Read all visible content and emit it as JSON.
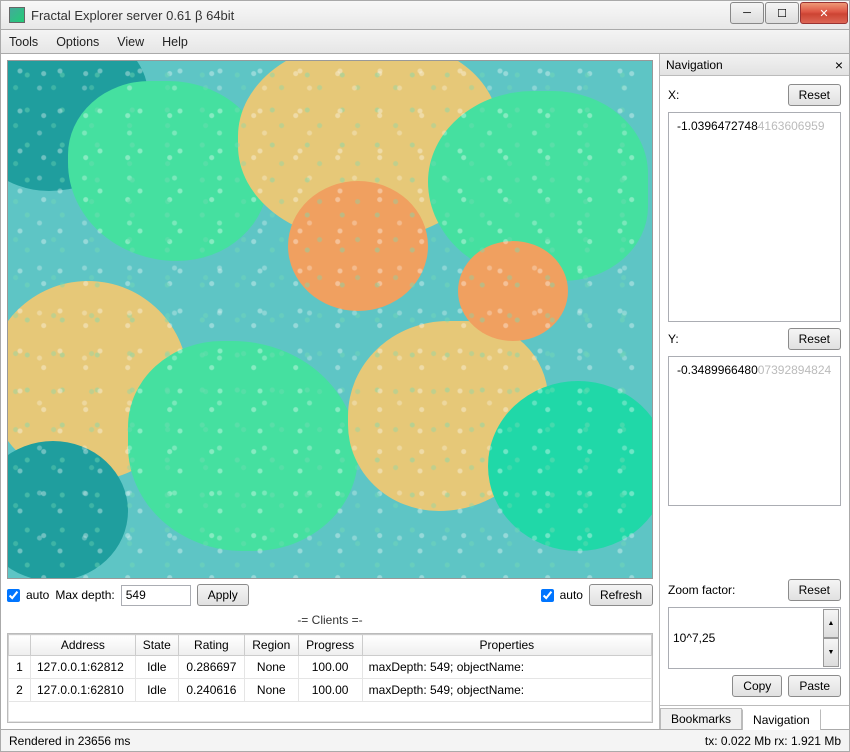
{
  "window": {
    "title": "Fractal Explorer server  0.61 β 64bit"
  },
  "menu": {
    "tools": "Tools",
    "options": "Options",
    "view": "View",
    "help": "Help"
  },
  "controls": {
    "auto_left": "auto",
    "max_depth_label": "Max depth:",
    "max_depth_value": "549",
    "apply": "Apply",
    "auto_right": "auto",
    "refresh": "Refresh"
  },
  "clients": {
    "header": "-= Clients =-",
    "columns": {
      "idx": "",
      "address": "Address",
      "state": "State",
      "rating": "Rating",
      "region": "Region",
      "progress": "Progress",
      "properties": "Properties"
    },
    "rows": [
      {
        "idx": "1",
        "address": "127.0.0.1:62812",
        "state": "Idle",
        "rating": "0.286697",
        "region": "None",
        "progress": "100.00",
        "properties": "maxDepth: 549; objectName:"
      },
      {
        "idx": "2",
        "address": "127.0.0.1:62810",
        "state": "Idle",
        "rating": "0.240616",
        "region": "None",
        "progress": "100.00",
        "properties": "maxDepth: 549; objectName:"
      }
    ]
  },
  "nav": {
    "title": "Navigation",
    "x_label": "X:",
    "y_label": "Y:",
    "reset": "Reset",
    "x_value_dark": "-1.0396472748",
    "x_value_faint": "4163606959",
    "y_value_dark": "-0.3489966480",
    "y_value_faint": "07392894824",
    "zoom_label": "Zoom factor:",
    "zoom_value": "10^7,25",
    "copy": "Copy",
    "paste": "Paste"
  },
  "tabs": {
    "bookmarks": "Bookmarks",
    "navigation": "Navigation"
  },
  "status": {
    "left": "Rendered in 23656 ms",
    "right": "tx: 0.022 Mb rx: 1.921 Mb"
  }
}
